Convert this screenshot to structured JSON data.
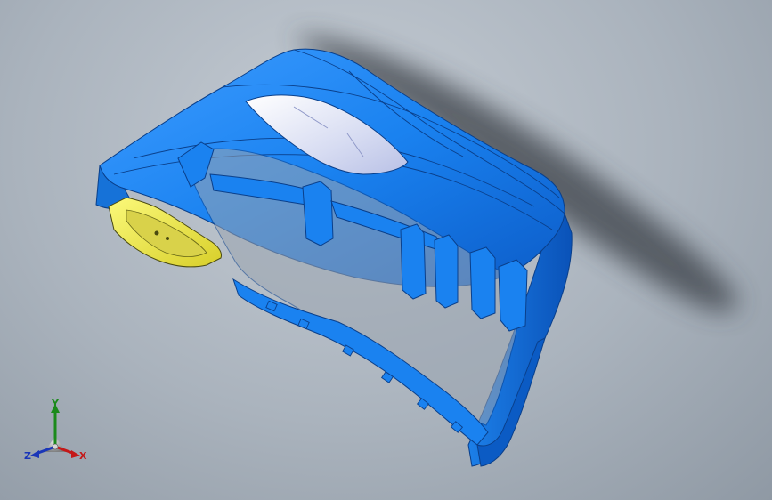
{
  "viewport": {
    "background": "#a9b2bc"
  },
  "model": {
    "part_color": "#1a82f0",
    "highlight_color": "#e8e64a",
    "glass_color": "#dfe4f4",
    "shadow_color": "#3a3f47"
  },
  "triad": {
    "x_label": "X",
    "y_label": "Y",
    "z_label": "Z",
    "x_color": "#c41818",
    "y_color": "#1b8a1b",
    "z_color": "#1a36b8"
  }
}
